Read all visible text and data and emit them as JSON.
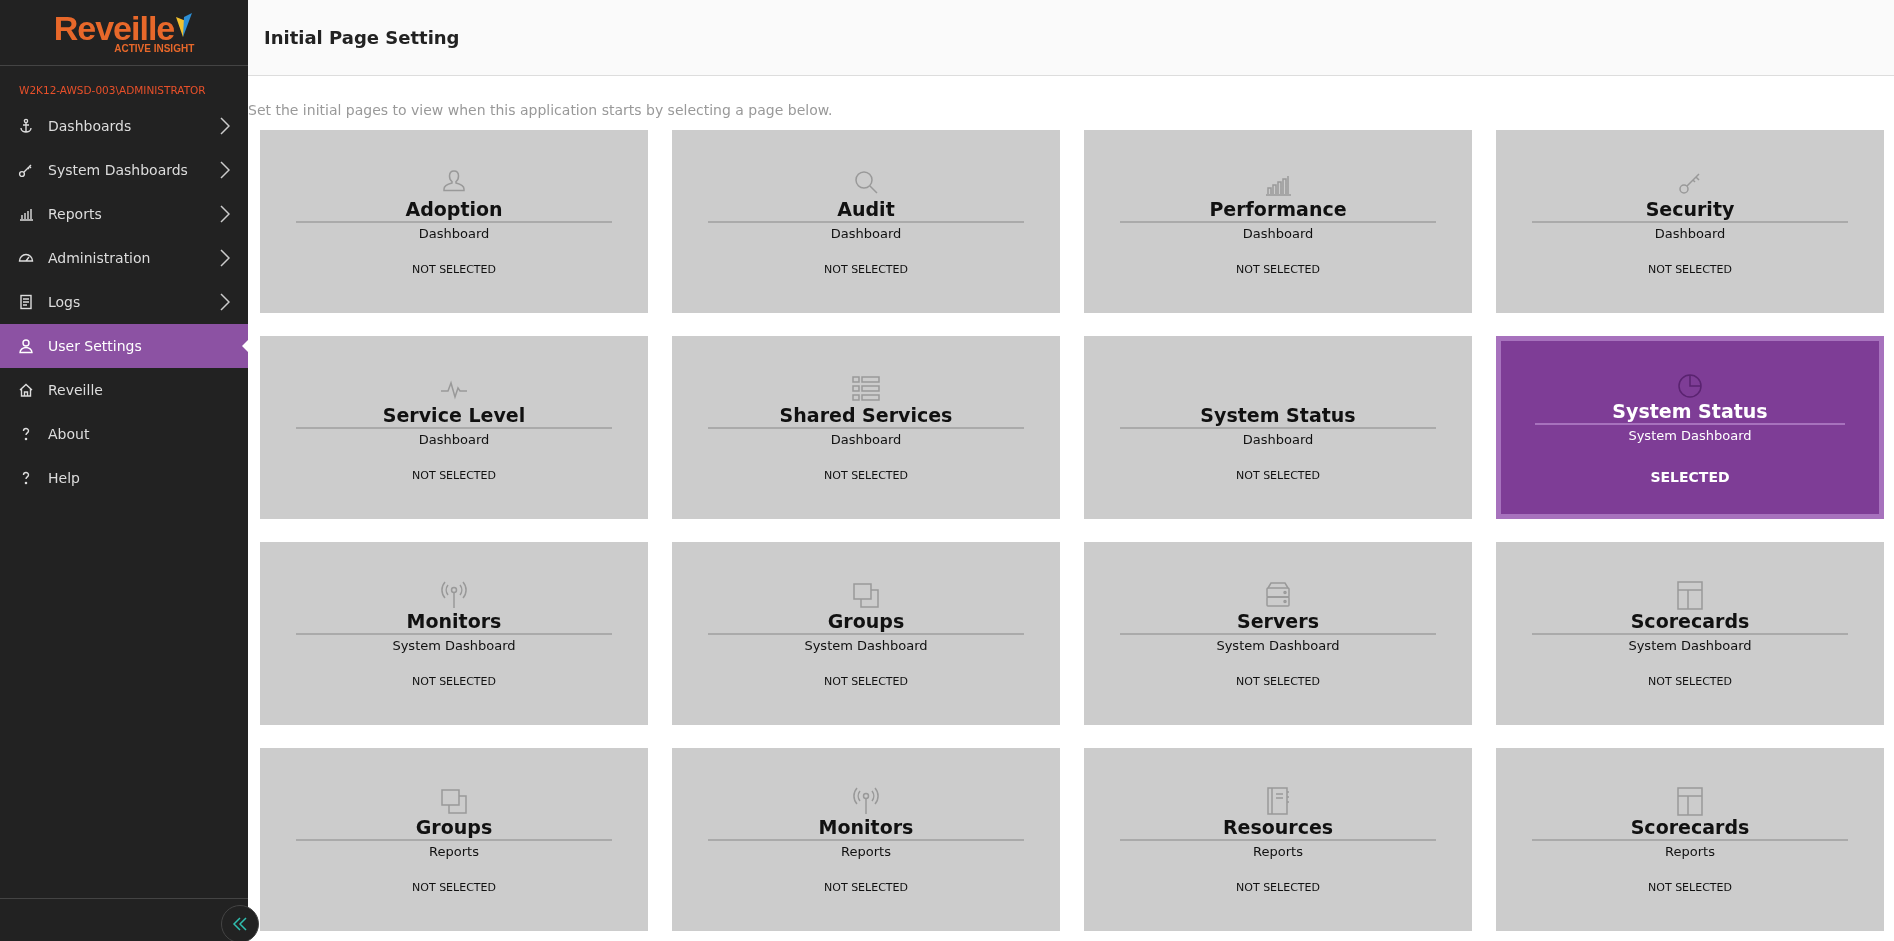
{
  "brand": {
    "name": "Reveille",
    "tagline": "ACTIVE INSIGHT"
  },
  "sidebar": {
    "user": "W2K12-AWSD-003\\ADMINISTRATOR",
    "items": [
      {
        "label": "Dashboards",
        "kind": "anchor",
        "expandable": true,
        "selected": false
      },
      {
        "label": "System Dashboards",
        "kind": "key",
        "expandable": true,
        "selected": false
      },
      {
        "label": "Reports",
        "kind": "bars",
        "expandable": true,
        "selected": false
      },
      {
        "label": "Administration",
        "kind": "gauge",
        "expandable": true,
        "selected": false
      },
      {
        "label": "Logs",
        "kind": "log",
        "expandable": true,
        "selected": false
      },
      {
        "label": "User Settings",
        "kind": "user",
        "expandable": false,
        "selected": true
      },
      {
        "label": "Reveille",
        "kind": "home",
        "expandable": false,
        "selected": false
      },
      {
        "label": "About",
        "kind": "question",
        "expandable": false,
        "selected": false
      },
      {
        "label": "Help",
        "kind": "question",
        "expandable": false,
        "selected": false
      }
    ]
  },
  "header": {
    "title": "Initial Page Setting"
  },
  "description": "Set the initial pages to view when this application starts by selecting a page below.",
  "cards": [
    {
      "title": "Adoption",
      "type": "Dashboard",
      "status": "NOT SELECTED",
      "kind": "user",
      "selected": false
    },
    {
      "title": "Audit",
      "type": "Dashboard",
      "status": "NOT SELECTED",
      "kind": "search",
      "selected": false
    },
    {
      "title": "Performance",
      "type": "Dashboard",
      "status": "NOT SELECTED",
      "kind": "bars",
      "selected": false
    },
    {
      "title": "Security",
      "type": "Dashboard",
      "status": "NOT SELECTED",
      "kind": "key",
      "selected": false
    },
    {
      "title": "Service Level",
      "type": "Dashboard",
      "status": "NOT SELECTED",
      "kind": "pulse",
      "selected": false
    },
    {
      "title": "Shared Services",
      "type": "Dashboard",
      "status": "NOT SELECTED",
      "kind": "list",
      "selected": false
    },
    {
      "title": "System Status",
      "type": "Dashboard",
      "status": "NOT SELECTED",
      "selected": false
    },
    {
      "title": "System Status",
      "type": "System Dashboard",
      "status": "SELECTED",
      "kind": "pie",
      "selected": true
    },
    {
      "title": "Monitors",
      "type": "System Dashboard",
      "status": "NOT SELECTED",
      "kind": "antenna",
      "selected": false
    },
    {
      "title": "Groups",
      "type": "System Dashboard",
      "status": "NOT SELECTED",
      "kind": "windows",
      "selected": false
    },
    {
      "title": "Servers",
      "type": "System Dashboard",
      "status": "NOT SELECTED",
      "kind": "server",
      "selected": false
    },
    {
      "title": "Scorecards",
      "type": "System Dashboard",
      "status": "NOT SELECTED",
      "kind": "scorecard",
      "selected": false
    },
    {
      "title": "Groups",
      "type": "Reports",
      "status": "NOT SELECTED",
      "kind": "windows",
      "selected": false
    },
    {
      "title": "Monitors",
      "type": "Reports",
      "status": "NOT SELECTED",
      "kind": "antenna",
      "selected": false
    },
    {
      "title": "Resources",
      "type": "Reports",
      "status": "NOT SELECTED",
      "kind": "book",
      "selected": false
    },
    {
      "title": "Scorecards",
      "type": "Reports",
      "status": "NOT SELECTED",
      "kind": "scorecard",
      "selected": false
    }
  ]
}
